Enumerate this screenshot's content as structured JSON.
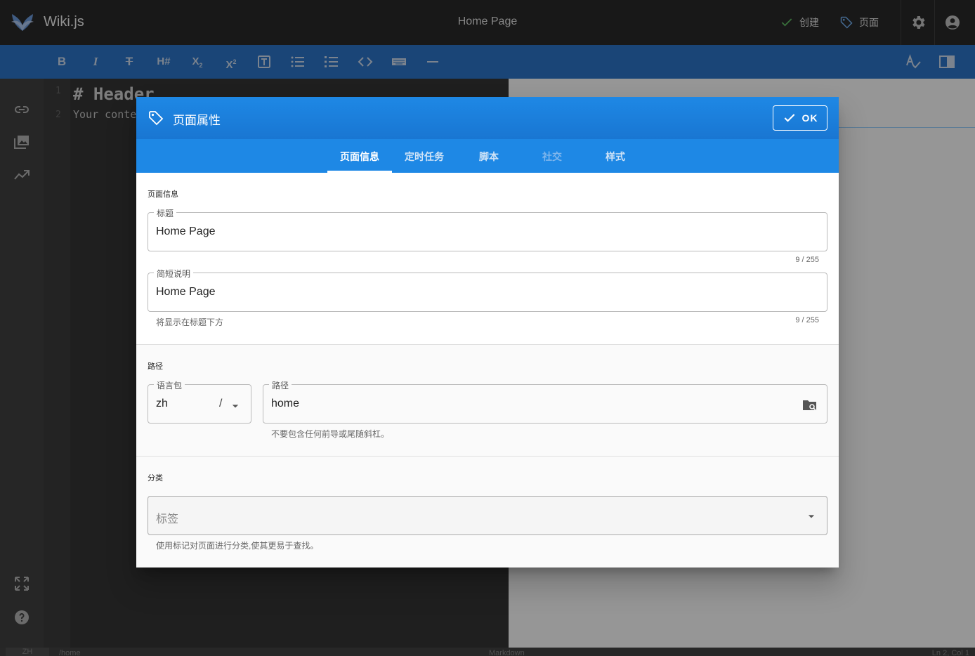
{
  "app": {
    "name": "Wiki.js",
    "page_title": "Home Page"
  },
  "topbar": {
    "create_label": "创建",
    "page_label": "页面"
  },
  "editor": {
    "line1_no": "1",
    "line2_no": "2",
    "line1": "# Header",
    "line2": "Your conten"
  },
  "statusbar": {
    "locale": "ZH",
    "path": "/home",
    "mode": "Markdown",
    "cursor": "Ln 2, Col 1"
  },
  "dialog": {
    "title": "页面属性",
    "ok_label": "OK",
    "tabs": [
      {
        "label": "页面信息",
        "state": "active"
      },
      {
        "label": "定时任务",
        "state": "normal"
      },
      {
        "label": "脚本",
        "state": "normal"
      },
      {
        "label": "社交",
        "state": "disabled"
      },
      {
        "label": "样式",
        "state": "normal"
      }
    ],
    "info": {
      "section_label": "页面信息",
      "title_legend": "标题",
      "title_value": "Home Page",
      "title_counter": "9 / 255",
      "desc_legend": "简短说明",
      "desc_value": "Home Page",
      "desc_hint": "将显示在标题下方",
      "desc_counter": "9 / 255"
    },
    "path": {
      "section_label": "路径",
      "locale_legend": "语言包",
      "locale_value": "zh",
      "locale_sep": "/",
      "path_legend": "路径",
      "path_value": "home",
      "path_hint": "不要包含任何前导或尾随斜杠。"
    },
    "categorization": {
      "section_label": "分类",
      "tags_placeholder": "标签",
      "tags_hint": "使用标记对页面进行分类,使其更易于查找。"
    }
  },
  "colors": {
    "primary": "#1976d2",
    "tab_bar": "#1e88e5",
    "toolbar": "#1565c0",
    "check_green": "#4caf50"
  }
}
